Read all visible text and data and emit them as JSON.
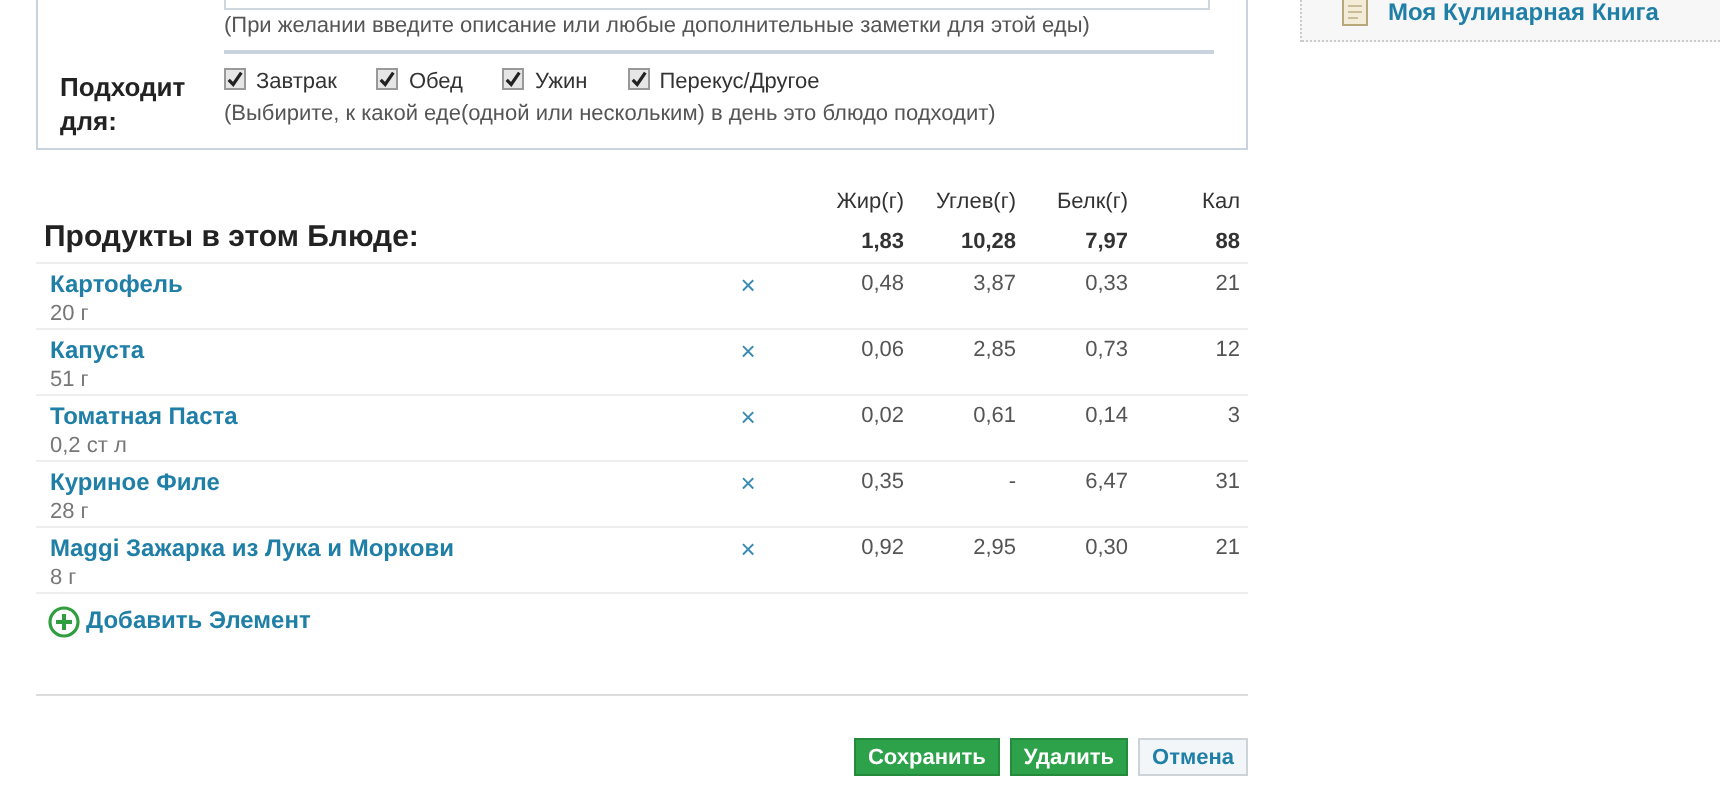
{
  "form": {
    "description_hint": "(При желании введите описание или любые дополнительные заметки для этой еды)",
    "suitable_label": "Подходит для:",
    "meals": [
      {
        "label": "Завтрак",
        "checked": true
      },
      {
        "label": "Обед",
        "checked": true
      },
      {
        "label": "Ужин",
        "checked": true
      },
      {
        "label": "Перекус/Другое",
        "checked": true
      }
    ],
    "meals_hint": "(Выбирите, к какой еде(одной или нескольким) в день это блюдо подходит)"
  },
  "sidebar": {
    "link": "Моя Кулинарная Книга"
  },
  "products": {
    "title": "Продукты в этом Блюде:",
    "columns": [
      "Жир(г)",
      "Углев(г)",
      "Белк(г)",
      "Кал"
    ],
    "totals": [
      "1,83",
      "10,28",
      "7,97",
      "88"
    ],
    "rows": [
      {
        "name": "Картофель",
        "amount": "20 г",
        "remove": "×",
        "values": [
          "0,48",
          "3,87",
          "0,33",
          "21"
        ]
      },
      {
        "name": "Капуста",
        "amount": "51 г",
        "remove": "×",
        "values": [
          "0,06",
          "2,85",
          "0,73",
          "12"
        ]
      },
      {
        "name": "Томатная Паста",
        "amount": "0,2 ст л",
        "remove": "×",
        "values": [
          "0,02",
          "0,61",
          "0,14",
          "3"
        ]
      },
      {
        "name": "Куриное Филе",
        "amount": "28 г",
        "remove": "×",
        "values": [
          "0,35",
          "-",
          "6,47",
          "31"
        ]
      },
      {
        "name": "Maggi Зажарка из Лука и Моркови",
        "amount": "8 г",
        "remove": "×",
        "values": [
          "0,92",
          "2,95",
          "0,30",
          "21"
        ]
      }
    ],
    "add": "Добавить Элемент"
  },
  "buttons": [
    {
      "label": "Сохранить",
      "kind": "primary"
    },
    {
      "label": "Удалить",
      "kind": "primary"
    },
    {
      "label": "Отмена",
      "kind": "secondary"
    }
  ]
}
